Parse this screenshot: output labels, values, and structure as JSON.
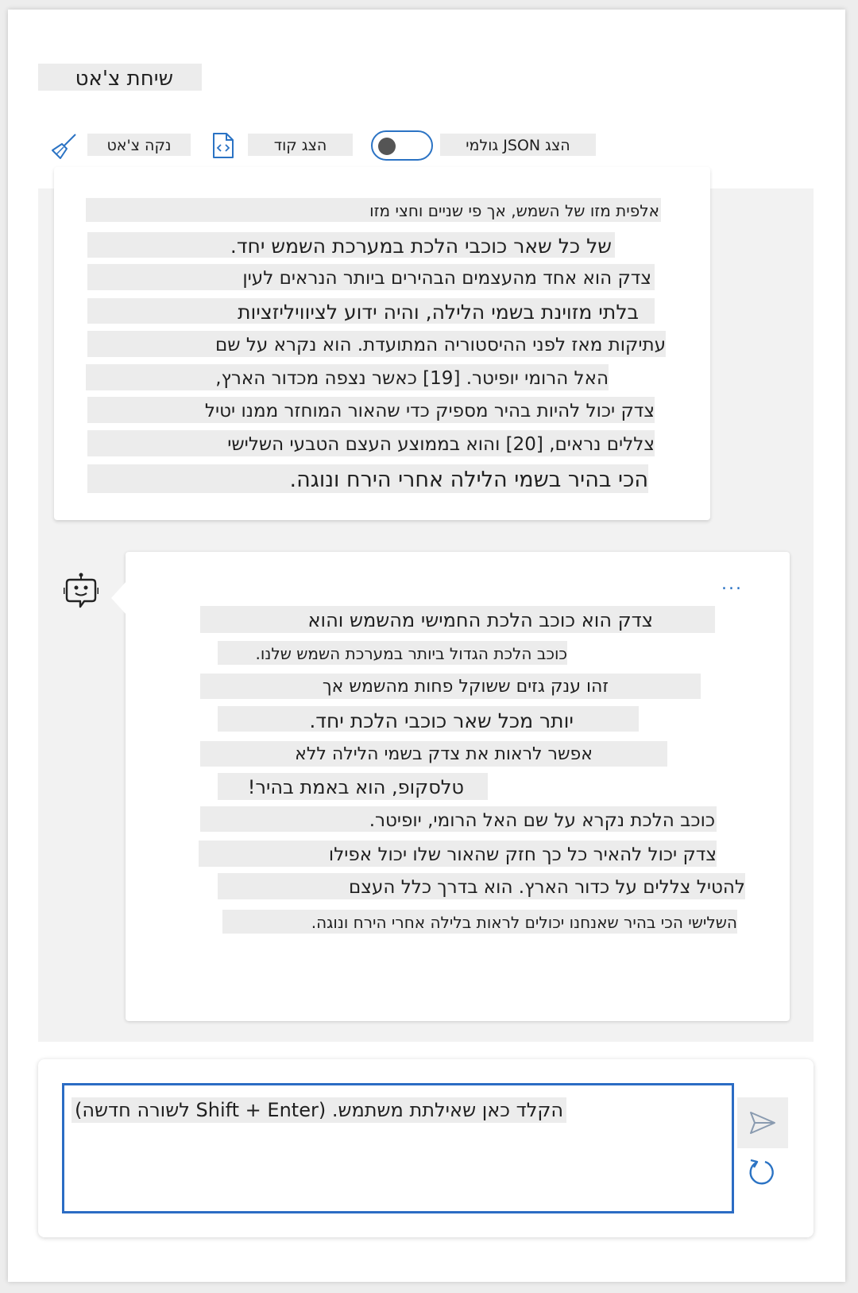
{
  "header": {
    "title": "שיחת צ'אט"
  },
  "toolbar": {
    "clear_label": "נקה צ'אט",
    "show_code_label": "הצג קוד",
    "raw_json_label": "הצג JSON גולמי",
    "raw_json_toggle_on": false
  },
  "messages": [
    {
      "role": "user",
      "lines": [
        "אלפית מזו של השמש, אך פי שניים וחצי מזו",
        "של כל שאר כוכבי הלכת במערכת השמש יחד.",
        "צדק הוא אחד מהעצמים הבהירים ביותר הנראים לעין",
        "בלתי מזוינת בשמי הלילה, והיה ידוע לציוויליזציות",
        "עתיקות מאז לפני ההיסטוריה המתועדת. הוא נקרא על שם",
        "האל הרומי יופיטר. [19] כאשר נצפה מכדור הארץ,",
        "צדק יכול להיות בהיר מספיק כדי שהאור המוחזר ממנו יטיל",
        "צללים נראים, [20] והוא בממוצע העצם הטבעי השלישי",
        "הכי בהיר בשמי הלילה אחרי הירח ונוגה."
      ]
    },
    {
      "role": "assistant",
      "more_label": "...",
      "lines": [
        "צדק הוא כוכב הלכת החמישי מהשמש והוא",
        "כוכב הלכת הגדול ביותר במערכת השמש שלנו.",
        "זהו ענק גזים ששוקל פחות מהשמש אך",
        "יותר מכל שאר כוכבי הלכת יחד.",
        "אפשר לראות את צדק בשמי הלילה ללא",
        "טלסקופ, הוא באמת בהיר!",
        "כוכב הלכת נקרא על שם האל הרומי, יופיטר.",
        "צדק יכול להאיר כל כך חזק שהאור שלו יכול אפילו",
        "להטיל צללים על כדור הארץ. הוא בדרך כלל העצם",
        "השלישי הכי בהיר שאנחנו יכולים לראות בלילה אחרי הירח ונוגה."
      ]
    }
  ],
  "input": {
    "placeholder": "הקלד כאן שאילתת משתמש. (Shift + Enter לשורה חדשה)",
    "value": ""
  },
  "icons": {
    "clear": "broom-icon",
    "code": "code-file-icon",
    "bot": "bot-icon",
    "send": "send-icon",
    "regenerate": "regenerate-icon"
  },
  "colors": {
    "accent": "#2b73c4",
    "highlight": "#ececec"
  }
}
